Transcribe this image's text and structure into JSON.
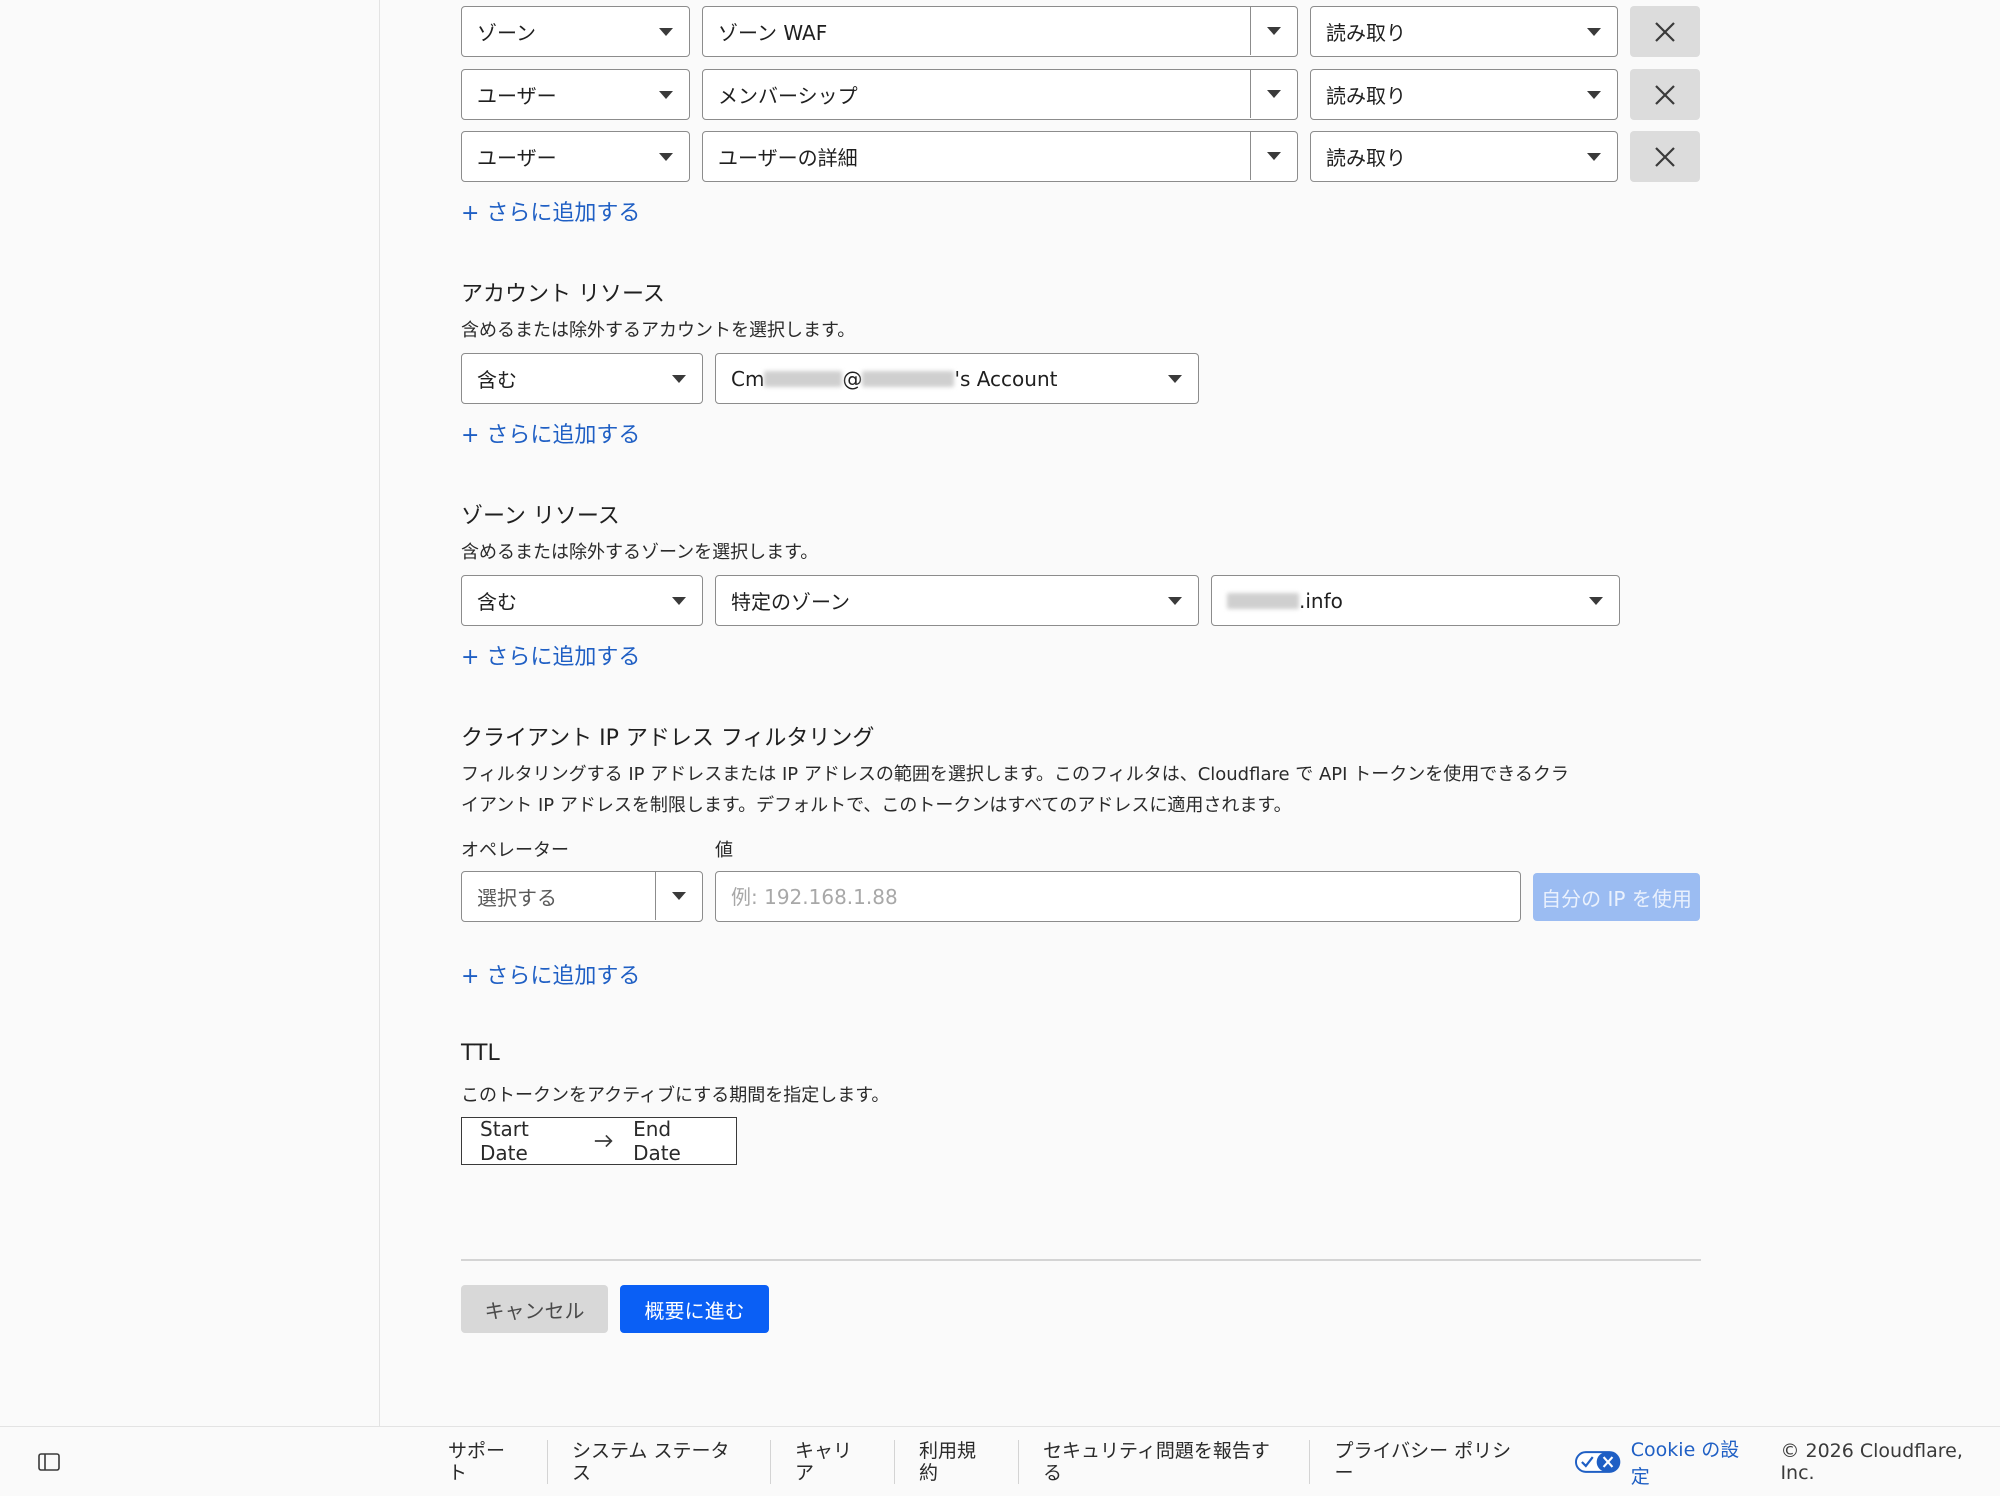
{
  "permissions": {
    "rows": [
      {
        "type": "ゾーン",
        "item": "ゾーン WAF",
        "access": "読み取り"
      },
      {
        "type": "ユーザー",
        "item": "メンバーシップ",
        "access": "読み取り"
      },
      {
        "type": "ユーザー",
        "item": "ユーザーの詳細",
        "access": "読み取り"
      }
    ],
    "add_more": "+ さらに追加する"
  },
  "account_resources": {
    "title": "アカウント リソース",
    "description": "含めるまたは除外するアカウントを選択します。",
    "include": "含む",
    "account_prefix": "Cm",
    "account_at": "@",
    "account_suffix": "'s Account",
    "add_more": "+ さらに追加する"
  },
  "zone_resources": {
    "title": "ゾーン リソース",
    "description": "含めるまたは除外するゾーンを選択します。",
    "include": "含む",
    "scope": "特定のゾーン",
    "zone_suffix": ".info",
    "add_more": "+ さらに追加する"
  },
  "ip_filtering": {
    "title": "クライアント IP アドレス フィルタリング",
    "description_line1": "フィルタリングする IP アドレスまたは IP アドレスの範囲を選択します。このフィルタは、Cloudflare で API トークンを使用できるクラ",
    "description_line2": "イアント IP アドレスを制限します。デフォルトで、このトークンはすべてのアドレスに適用されます。",
    "operator_label": "オペレーター",
    "value_label": "値",
    "operator_placeholder": "選択する",
    "value_placeholder": "例: 192.168.1.88",
    "use_my_ip": "自分の IP を使用",
    "add_more": "+ さらに追加する"
  },
  "ttl": {
    "title": "TTL",
    "description": "このトークンをアクティブにする期間を指定します。",
    "start_date": "Start Date",
    "end_date": "End Date"
  },
  "actions": {
    "cancel": "キャンセル",
    "continue": "概要に進む"
  },
  "footer": {
    "links": [
      "サポート",
      "システム ステータス",
      "キャリア",
      "利用規約",
      "セキュリティ問題を報告する",
      "プライバシー ポリシー"
    ],
    "cookie": "Cookie の設定",
    "copyright": "© 2026 Cloudflare, Inc."
  },
  "colors": {
    "link": "#1f5fc4",
    "primary": "#0a5ff5",
    "disabled_primary": "#9bbcf2"
  }
}
